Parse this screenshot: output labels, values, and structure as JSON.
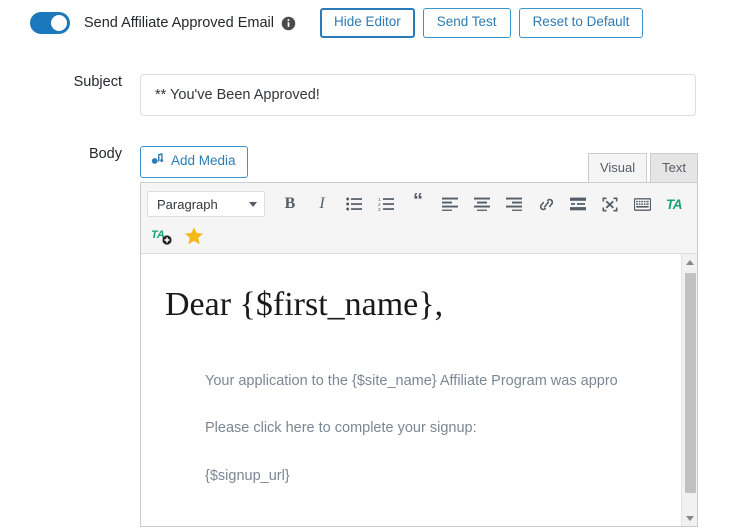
{
  "header": {
    "toggle": {
      "name": "send-affiliate-approved-email-toggle",
      "state": "on"
    },
    "label": "Send Affiliate Approved Email",
    "info_icon": "info-icon",
    "buttons": [
      {
        "label": "Hide Editor",
        "focused": true
      },
      {
        "label": "Send Test",
        "focused": false
      },
      {
        "label": "Reset to Default",
        "focused": false
      }
    ]
  },
  "fields": {
    "subject": {
      "label": "Subject",
      "value": "** You've Been Approved!",
      "placeholder": ""
    },
    "body": {
      "label": "Body"
    }
  },
  "editor": {
    "add_media_label": "Add Media",
    "tabs": [
      {
        "label": "Visual",
        "active": true
      },
      {
        "label": "Text",
        "active": false
      }
    ],
    "format_select": {
      "value": "Paragraph"
    },
    "toolbar_row1": [
      {
        "name": "bold-icon",
        "glyph": "B"
      },
      {
        "name": "italic-icon",
        "glyph": "I"
      },
      {
        "name": "bulleted-list-icon",
        "glyph": ""
      },
      {
        "name": "numbered-list-icon",
        "glyph": ""
      },
      {
        "name": "blockquote-icon",
        "glyph": "“"
      },
      {
        "name": "align-left-icon",
        "glyph": ""
      },
      {
        "name": "align-center-icon",
        "glyph": ""
      },
      {
        "name": "align-right-icon",
        "glyph": ""
      },
      {
        "name": "insert-link-icon",
        "glyph": ""
      },
      {
        "name": "insert-read-more-icon",
        "glyph": ""
      },
      {
        "name": "fullscreen-icon",
        "glyph": ""
      },
      {
        "name": "keyboard-shortcuts-icon",
        "glyph": ""
      },
      {
        "name": "toolbar-toggle-icon",
        "glyph": "TA"
      }
    ],
    "toolbar_row2": [
      {
        "name": "tinymce-advanced-add-icon",
        "glyph": "TA"
      },
      {
        "name": "star-icon",
        "glyph": "★"
      }
    ],
    "content": {
      "heading": "Dear {$first_name},",
      "paragraph_1": "Your application to the {$site_name} Affiliate Program was appro",
      "paragraph_2": "Please click here to complete your signup:",
      "paragraph_3": "{$signup_url}"
    },
    "scrollbar": {
      "up_icon": "scroll-up-arrow-icon",
      "down_icon": "scroll-down-arrow-icon"
    }
  },
  "colors": {
    "accent": "#2e7cb5",
    "toggle_on": "#1b78bd",
    "ta_teal": "#1aa179",
    "star_gold": "#f0b323",
    "body_text": "#7b8794"
  }
}
